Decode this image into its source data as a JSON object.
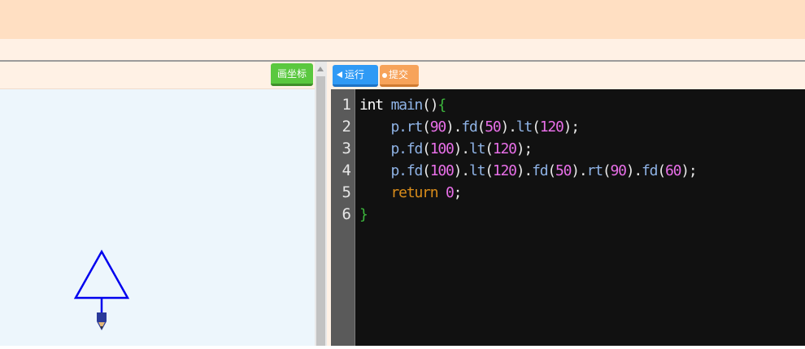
{
  "toolbar_left": {
    "axis_button": "画坐标"
  },
  "toolbar_right": {
    "run_button": "运行",
    "submit_button": "提交"
  },
  "editor": {
    "line_numbers": [
      "1",
      "2",
      "3",
      "4",
      "5",
      "6"
    ],
    "colors": {
      "background": "#111111",
      "gutter": "#5a5a5a",
      "text": "#e8e8e8",
      "function": "#8fb3e6",
      "number": "#e86fe8",
      "keyword": "#d98c1a",
      "brace": "#3db83d",
      "type": "#ffffff"
    },
    "lines": [
      [
        {
          "text": "int ",
          "class": "type"
        },
        {
          "text": "main",
          "class": "function"
        },
        {
          "text": "()",
          "class": "text"
        },
        {
          "text": "{",
          "class": "brace"
        }
      ],
      [
        {
          "text": "    p.rt",
          "class": "function"
        },
        {
          "text": "(",
          "class": "text"
        },
        {
          "text": "90",
          "class": "number"
        },
        {
          "text": ").",
          "class": "text"
        },
        {
          "text": "fd",
          "class": "function"
        },
        {
          "text": "(",
          "class": "text"
        },
        {
          "text": "50",
          "class": "number"
        },
        {
          "text": ").",
          "class": "text"
        },
        {
          "text": "lt",
          "class": "function"
        },
        {
          "text": "(",
          "class": "text"
        },
        {
          "text": "120",
          "class": "number"
        },
        {
          "text": ");",
          "class": "text"
        }
      ],
      [
        {
          "text": "    p.fd",
          "class": "function"
        },
        {
          "text": "(",
          "class": "text"
        },
        {
          "text": "100",
          "class": "number"
        },
        {
          "text": ").",
          "class": "text"
        },
        {
          "text": "lt",
          "class": "function"
        },
        {
          "text": "(",
          "class": "text"
        },
        {
          "text": "120",
          "class": "number"
        },
        {
          "text": ");",
          "class": "text"
        }
      ],
      [
        {
          "text": "    p.fd",
          "class": "function"
        },
        {
          "text": "(",
          "class": "text"
        },
        {
          "text": "100",
          "class": "number"
        },
        {
          "text": ").",
          "class": "text"
        },
        {
          "text": "lt",
          "class": "function"
        },
        {
          "text": "(",
          "class": "text"
        },
        {
          "text": "120",
          "class": "number"
        },
        {
          "text": ").",
          "class": "text"
        },
        {
          "text": "fd",
          "class": "function"
        },
        {
          "text": "(",
          "class": "text"
        },
        {
          "text": "50",
          "class": "number"
        },
        {
          "text": ").",
          "class": "text"
        },
        {
          "text": "rt",
          "class": "function"
        },
        {
          "text": "(",
          "class": "text"
        },
        {
          "text": "90",
          "class": "number"
        },
        {
          "text": ").",
          "class": "text"
        },
        {
          "text": "fd",
          "class": "function"
        },
        {
          "text": "(",
          "class": "text"
        },
        {
          "text": "60",
          "class": "number"
        },
        {
          "text": ");",
          "class": "text"
        }
      ],
      [
        {
          "text": "    return ",
          "class": "keyword"
        },
        {
          "text": "0",
          "class": "number"
        },
        {
          "text": ";",
          "class": "text"
        }
      ],
      [
        {
          "text": "}",
          "class": "brace"
        }
      ]
    ]
  },
  "drawing": {
    "stroke_color": "#0000ee",
    "pen_icon": "pencil-cursor-icon"
  }
}
